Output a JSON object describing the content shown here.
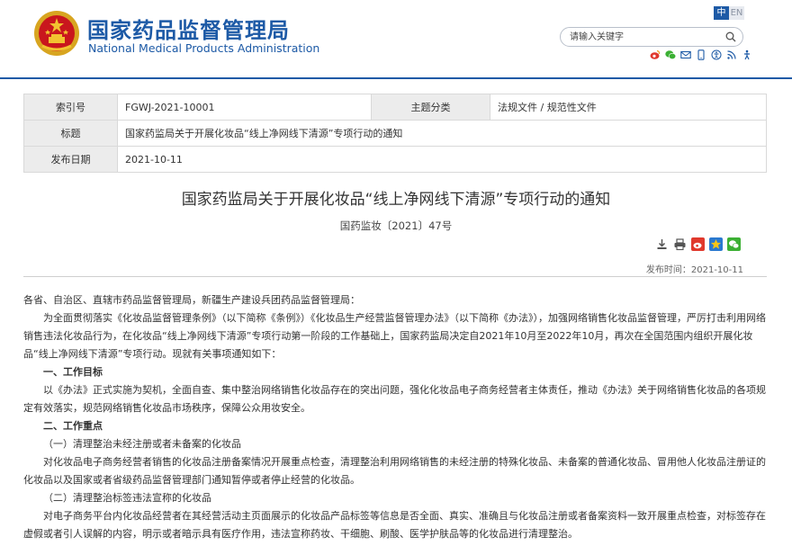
{
  "header": {
    "brand_cn": "国家药品监督管理局",
    "brand_en": "National Medical Products Administration",
    "lang_cn": "中",
    "lang_en": "EN",
    "search_placeholder": "请输入关键字",
    "social_icons": [
      "weibo-icon",
      "wechat-icon",
      "mail-icon",
      "mobile-icon",
      "accessibility-icon",
      "rss-icon",
      "elderly-mode-icon"
    ]
  },
  "meta": {
    "index_label": "索引号",
    "index_value": "FGWJ-2021-10001",
    "category_label": "主题分类",
    "category_value": "法规文件 / 规范性文件",
    "title_label": "标题",
    "title_value": "国家药监局关于开展化妆品“线上净网线下清源”专项行动的通知",
    "date_label": "发布日期",
    "date_value": "2021-10-11"
  },
  "article": {
    "title": "国家药监局关于开展化妆品“线上净网线下清源”专项行动的通知",
    "doc_number": "国药监妆〔2021〕47号",
    "pub_date": "发布时间：2021-10-11",
    "tools": [
      "download-icon",
      "print-icon",
      "share-weibo-icon",
      "favorite-icon",
      "share-wechat-icon"
    ],
    "paragraphs": [
      {
        "type": "plain",
        "text": "各省、自治区、直辖市药品监督管理局，新疆生产建设兵团药品监督管理局："
      },
      {
        "type": "indent",
        "text": "为全面贯彻落实《化妆品监督管理条例》（以下简称《条例》）《化妆品生产经营监督管理办法》（以下简称《办法》），加强网络销售化妆品监督管理，严厉打击利用网络销售违法化妆品行为，在化妆品“线上净网线下清源”专项行动第一阶段的工作基础上，国家药监局决定自2021年10月至2022年10月，再次在全国范围内组织开展化妆品“线上净网线下清源”专项行动。现就有关事项通知如下："
      },
      {
        "type": "h1",
        "text": "一、工作目标"
      },
      {
        "type": "indent",
        "text": "以《办法》正式实施为契机，全面自查、集中整治网络销售化妆品存在的突出问题，强化化妆品电子商务经营者主体责任，推动《办法》关于网络销售化妆品的各项规定有效落实，规范网络销售化妆品市场秩序，保障公众用妆安全。"
      },
      {
        "type": "h1",
        "text": "二、工作重点"
      },
      {
        "type": "h2",
        "text": "（一）清理整治未经注册或者未备案的化妆品"
      },
      {
        "type": "indent",
        "text": "对化妆品电子商务经营者销售的化妆品注册备案情况开展重点检查，清理整治利用网络销售的未经注册的特殊化妆品、未备案的普通化妆品、冒用他人化妆品注册证的化妆品以及国家或者省级药品监督管理部门通知暂停或者停止经营的化妆品。"
      },
      {
        "type": "h2",
        "text": "（二）清理整治标签违法宣称的化妆品"
      },
      {
        "type": "indent",
        "text": "对电子商务平台内化妆品经营者在其经营活动主页面展示的化妆品产品标签等信息是否全面、真实、准确且与化妆品注册或者备案资料一致开展重点检查，对标签存在虚假或者引人误解的内容，明示或者暗示具有医疗作用，违法宣称药妆、干细胞、刷酸、医学护肤品等的化妆品进行清理整治。"
      }
    ]
  }
}
